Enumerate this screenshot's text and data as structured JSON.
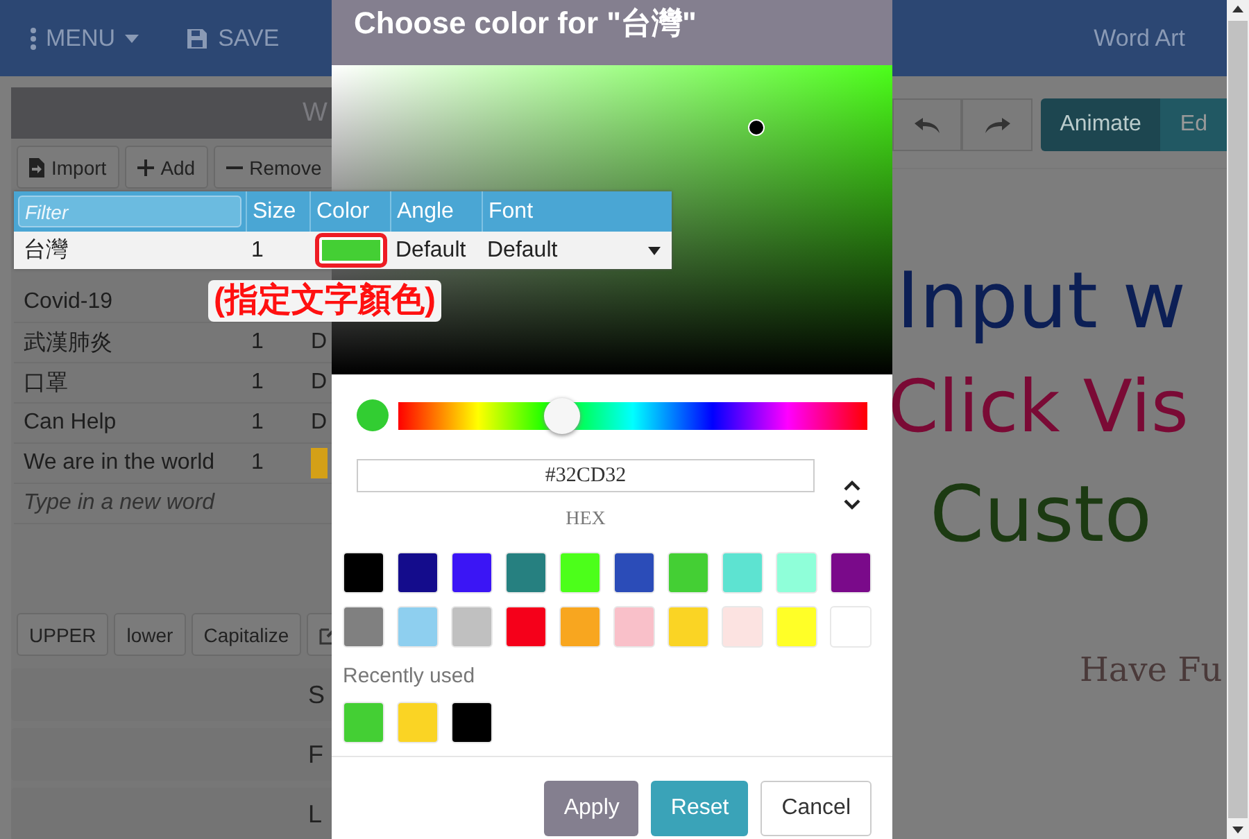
{
  "topbar": {
    "menu": "MENU",
    "save": "SAVE",
    "title": "Word Art"
  },
  "panel": {
    "title": "W",
    "toolbar": [
      "Import",
      "Add",
      "Remove"
    ]
  },
  "table": {
    "filter_placeholder": "Filter",
    "columns": [
      "Size",
      "Color",
      "Angle",
      "Font"
    ],
    "active_row": {
      "word": "台灣",
      "size": "1",
      "color": "#44cf34",
      "angle": "Default",
      "font": "Default"
    },
    "rows": [
      {
        "word": "Covid-19",
        "size": "",
        "color_text": ""
      },
      {
        "word": "武漢肺炎",
        "size": "1",
        "color_text": "D"
      },
      {
        "word": "口罩",
        "size": "1",
        "color_text": "D"
      },
      {
        "word": "Can Help",
        "size": "1",
        "color_text": "D"
      },
      {
        "word": "We are in the world",
        "size": "1",
        "color_text": "",
        "color": "#d4a017"
      }
    ],
    "new_word_placeholder": "Type in a new word"
  },
  "annotation": "(指定文字顏色)",
  "case_buttons": [
    "UPPER",
    "lower",
    "Capitalize"
  ],
  "sections": [
    "S",
    "F",
    "L"
  ],
  "right_toolbar": [
    {
      "label": "Animate",
      "selected": true
    },
    {
      "label": "Ed",
      "selected": false
    }
  ],
  "canvas_words": [
    {
      "text": "Input w",
      "color": "#0c1f55"
    },
    {
      "text": "Click Vis",
      "color": "#7a0a35"
    },
    {
      "text": "Custo",
      "color": "#1c3a12"
    },
    {
      "text": "Have Fu",
      "color": "#4a3a3a"
    }
  ],
  "dialog": {
    "title": "Choose color for \"台灣\"",
    "preview": {
      "color": "#32cd32"
    },
    "hue": {
      "level": 0.35
    },
    "hex": "#32CD32",
    "hex_label": "HEX",
    "swatches": [
      {
        "color": "#000000"
      },
      {
        "color": "#140c8c"
      },
      {
        "color": "#3b15f5"
      },
      {
        "color": "#268080"
      },
      {
        "color": "#4cff1a"
      },
      {
        "color": "#2b4cb8"
      },
      {
        "color": "#44cf34"
      },
      {
        "color": "#5de3d1"
      },
      {
        "color": "#8fffd9"
      },
      {
        "color": "#7a0a8a"
      },
      {
        "color": "#808080"
      },
      {
        "color": "#8ecfef"
      },
      {
        "color": "#c0c0c0"
      },
      {
        "color": "#f5001a"
      },
      {
        "color": "#f8a61f"
      },
      {
        "color": "#f9c0c9"
      },
      {
        "color": "#fad424"
      },
      {
        "color": "#fce3e1"
      },
      {
        "color": "#ffff27"
      },
      {
        "color": "#ffffff"
      }
    ],
    "recent_label": "Recently used",
    "recent": [
      {
        "color": "#44cf34"
      },
      {
        "color": "#fad424"
      },
      {
        "color": "#000000"
      }
    ],
    "buttons": [
      {
        "label": "Apply",
        "kind": "apply"
      },
      {
        "label": "Reset",
        "kind": "reset"
      },
      {
        "label": "Cancel",
        "kind": "cancel"
      }
    ]
  }
}
